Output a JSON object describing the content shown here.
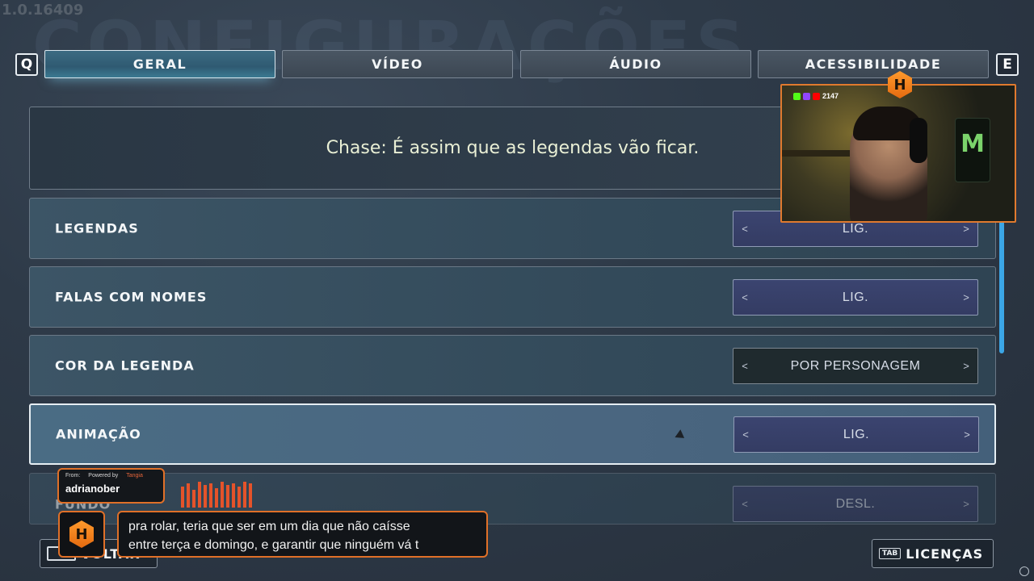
{
  "version": "1.0.16409",
  "bg_title": "CONFIGURAÇÕES",
  "keys": {
    "left": "Q",
    "right": "E"
  },
  "tabs": [
    {
      "label": "GERAL",
      "active": true
    },
    {
      "label": "VÍDEO",
      "active": false
    },
    {
      "label": "ÁUDIO",
      "active": false
    },
    {
      "label": "ACESSIBILIDADE",
      "active": false
    }
  ],
  "preview_text": "Chase: É assim que as legendas vão ficar.",
  "settings": [
    {
      "label": "LEGENDAS",
      "value": "LIG."
    },
    {
      "label": "FALAS COM NOMES",
      "value": "LIG."
    },
    {
      "label": "COR DA LEGENDA",
      "value": "POR PERSONAGEM"
    },
    {
      "label": "ANIMAÇÃO",
      "value": "LIG."
    },
    {
      "label": "FUNDO",
      "value": "DESL."
    }
  ],
  "arrows": {
    "left": "<",
    "right": ">"
  },
  "bottom": {
    "back_label": "VOLTAR",
    "tab_key": "TAB",
    "licenses_label": "LICENÇAS"
  },
  "webcam": {
    "viewer_count": "2147",
    "logo_letter": "H"
  },
  "tangia": {
    "from_label": "From:",
    "powered_label": "Powered by",
    "brand": "Tangia",
    "username": "adrianober",
    "message_line1": "pra rolar, teria que ser em um dia que não caísse",
    "message_line2": "entre terça e domingo, e garantir que ninguém vá t"
  },
  "colors": {
    "accent_orange": "#e07028",
    "scrollbar_blue": "#3ba6e6",
    "selector_blue": "#3b4470"
  }
}
